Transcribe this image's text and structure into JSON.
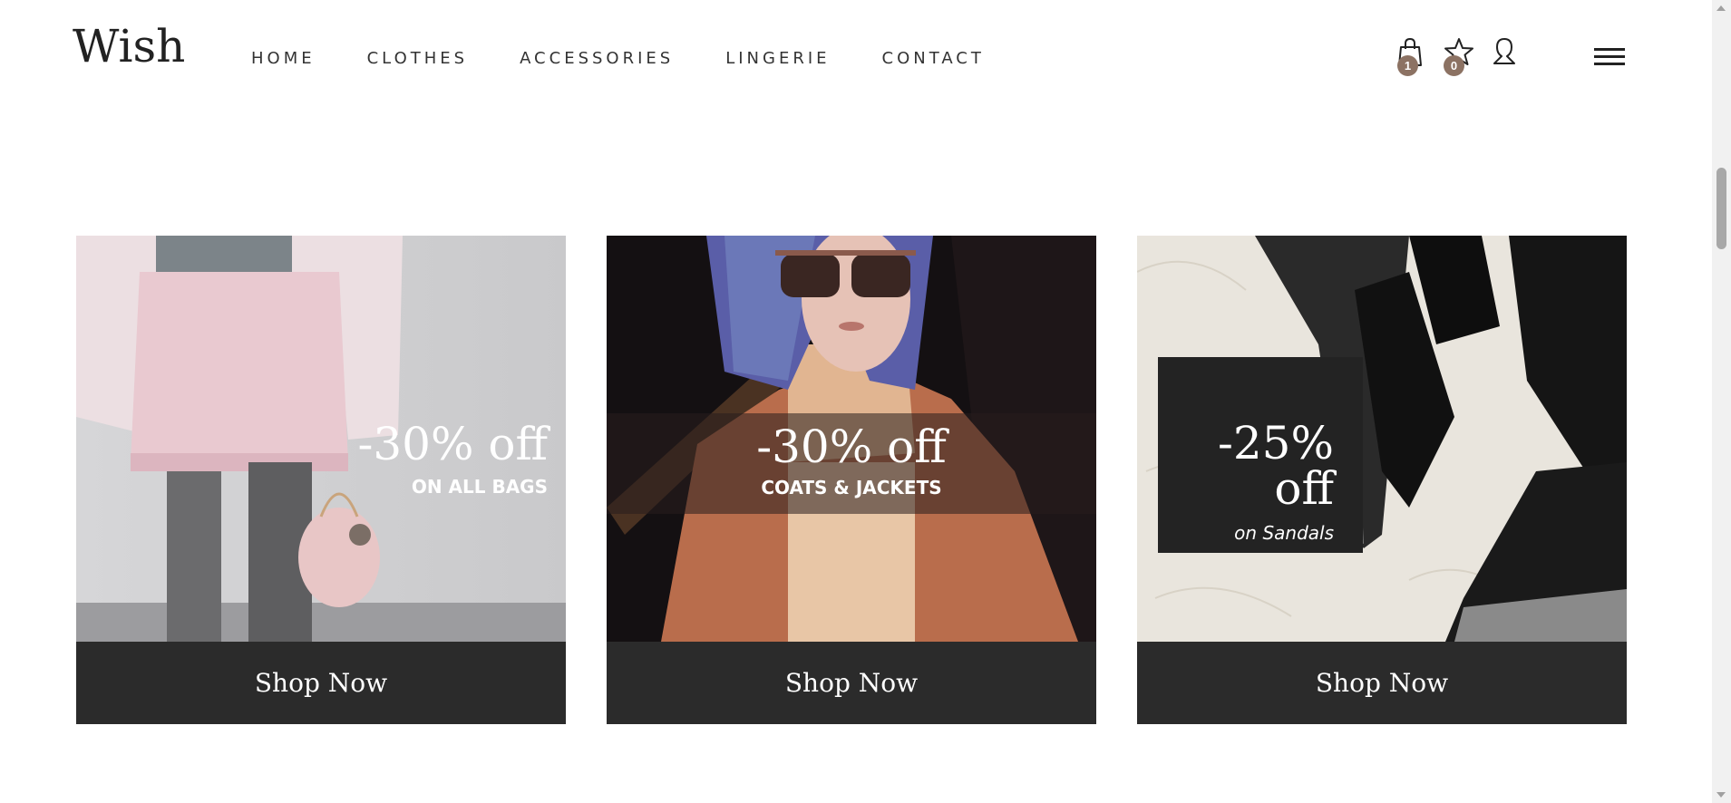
{
  "header": {
    "logo": "Wish",
    "nav": [
      "HOME",
      "CLOTHES",
      "ACCESSORIES",
      "LINGERIE",
      "CONTACT"
    ],
    "cart_count": "1",
    "wishlist_count": "0",
    "icons": [
      "bag-icon",
      "star-icon",
      "user-icon",
      "hamburger-icon"
    ]
  },
  "promos": [
    {
      "discount": "-30% off",
      "subtitle": "ON ALL BAGS",
      "button": "Shop Now"
    },
    {
      "discount": "-30% off",
      "subtitle": "COATS & JACKETS",
      "button": "Shop Now"
    },
    {
      "discount": "-25% off",
      "subtitle": "on Sandals",
      "button": "Shop Now"
    }
  ],
  "colors": {
    "badge": "#8c7263",
    "button_bg": "#2b2b2b",
    "text_dark": "#222222"
  }
}
